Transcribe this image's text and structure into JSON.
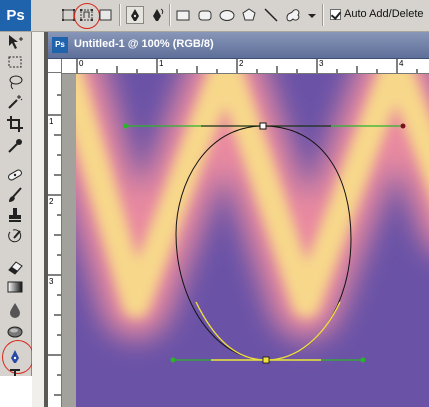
{
  "app": {
    "logo_text": "Ps"
  },
  "options_bar": {
    "tools": [
      {
        "icon": "shape-layers-icon"
      },
      {
        "icon": "paths-icon",
        "highlighted": true
      },
      {
        "icon": "fill-pixels-icon"
      },
      {
        "icon": "pen-tool-icon"
      },
      {
        "icon": "freeform-pen-icon"
      },
      {
        "icon": "rectangle-shape-icon"
      },
      {
        "icon": "rounded-rectangle-icon"
      },
      {
        "icon": "ellipse-shape-icon"
      },
      {
        "icon": "polygon-shape-icon"
      },
      {
        "icon": "line-shape-icon"
      },
      {
        "icon": "custom-shape-icon"
      },
      {
        "icon": "dropdown-arrow-icon"
      }
    ],
    "auto_add_delete": {
      "label": "Auto Add/Delete",
      "checked": true
    }
  },
  "toolbox": {
    "tools": [
      "move-tool-icon",
      "marquee-tool-icon",
      "lasso-tool-icon",
      "magic-wand-tool-icon",
      "crop-tool-icon",
      "eyedropper-tool-icon",
      "healing-brush-tool-icon",
      "brush-tool-icon",
      "clone-stamp-tool-icon",
      "history-brush-tool-icon",
      "eraser-tool-icon",
      "gradient-tool-icon",
      "blur-tool-icon",
      "dodge-tool-icon",
      "pen-tool-icon",
      "type-tool-icon"
    ],
    "active_tool": "pen-tool-icon"
  },
  "document": {
    "title": "Untitled-1 @ 100% (RGB/8)",
    "ruler_h_labels": [
      "0",
      "1",
      "2",
      "3",
      "4"
    ],
    "ruler_v_labels": [
      "1",
      "2",
      "3"
    ]
  },
  "colors": {
    "highlight_circle": "#d9261c",
    "path_stroke": "#111111",
    "handle_line": "#2bb42b",
    "selected_handle_line": "#f0e040",
    "canvas_purple": "#6a52a6",
    "canvas_yellow": "#f7d88a"
  }
}
